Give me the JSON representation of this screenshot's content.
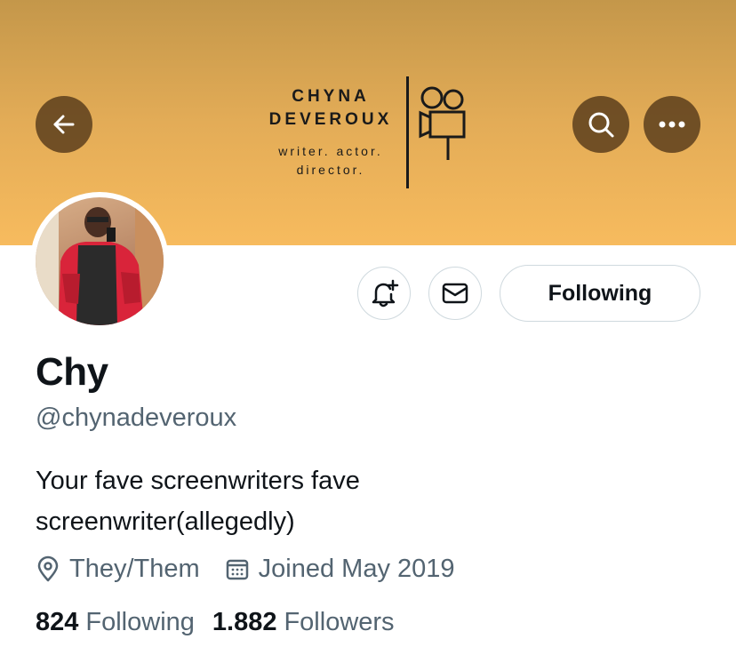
{
  "banner": {
    "logo_name_line1": "CHYNA",
    "logo_name_line2": "DEVEROUX",
    "logo_tagline_line1": "writer. actor.",
    "logo_tagline_line2": "director.",
    "logo_icon": "film-camera-icon"
  },
  "nav": {
    "back_icon": "arrow-left-icon",
    "search_icon": "search-icon",
    "more_icon": "more-horizontal-icon"
  },
  "actions": {
    "notify_icon": "bell-plus-icon",
    "message_icon": "envelope-icon",
    "follow_label": "Following"
  },
  "profile": {
    "display_name": "Chy",
    "handle": "@chynadeveroux",
    "bio_line1": "Your fave screenwriters fave",
    "bio_line2": "screenwriter(allegedly)",
    "location": "They/Them",
    "joined": "Joined May 2019",
    "following_count": "824",
    "following_label": "Following",
    "followers_count": "1.882",
    "followers_label": "Followers"
  },
  "colors": {
    "banner_top": "#c4974a",
    "banner_bottom": "#f7bb5e",
    "secondary_text": "#536471",
    "border": "#cfd9de"
  }
}
